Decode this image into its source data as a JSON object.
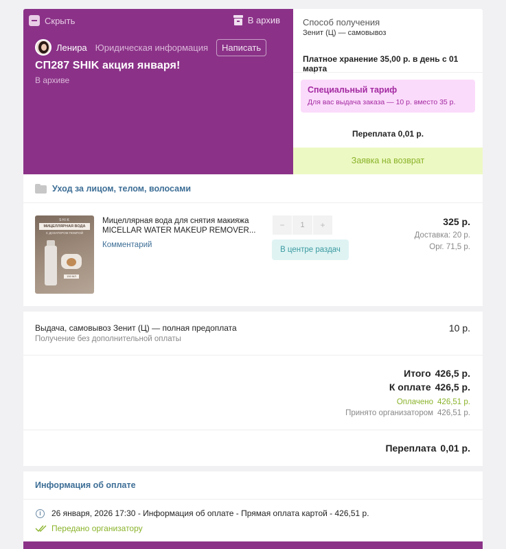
{
  "header": {
    "hide_label": "Скрыть",
    "archive_label": "В архив",
    "user_name": "Ленира",
    "legal_info": "Юридическая информация",
    "write_label": "Написать",
    "title": "СП287 SHIK акция января!",
    "status": "В архиве",
    "colors": {
      "accent": "#8b3288"
    }
  },
  "delivery_panel": {
    "method_label": "Способ получения",
    "method_value": "Зенит (Ц) — самовывоз",
    "storage_text": "Платное хранение 35,00 р. в день с 01 марта",
    "tariff_title": "Специальный тариф",
    "tariff_text": "Для вас выдача заказа — 10 р. вместо 35 р.",
    "overpay_text": "Переплата  0,01 р.",
    "refund_label": "Заявка на возврат"
  },
  "category": {
    "icon": "folder-icon",
    "label": "Уход за лицом, телом, волосами"
  },
  "product": {
    "image_brand": "SHIK",
    "image_banner": "МИЦЕЛЛЯРНАЯ ВОДА",
    "image_sub": "С ДОЗАТОРОМ ПОМПОЙ",
    "image_volume": "150 МЛ",
    "name": "Мицеллярная вода для снятия макияжа MICELLAR WATER MAKEUP REMOVER...",
    "comment_label": "Комментарий",
    "qty_minus": "−",
    "quantity": "1",
    "qty_plus": "+",
    "pickup_status": "В центре раздач",
    "price": "325 р.",
    "delivery": "Доставка: 20 р.",
    "org_fee": "Орг. 71,5 р."
  },
  "shipping": {
    "title": "Выдача, самовывоз Зенит (Ц) — полная предоплата",
    "subtitle": "Получение без дополнительной оплаты",
    "price": "10 р."
  },
  "totals": {
    "total_label": "Итого",
    "total_value": "426,5 р.",
    "to_pay_label": "К оплате",
    "to_pay_value": "426,5 р.",
    "paid_label": "Оплачено",
    "paid_value": "426,51 р.",
    "accepted_label": "Принято организатором",
    "accepted_value": "426,51 р.",
    "overpay_label": "Переплата",
    "overpay_value": "0,01 р."
  },
  "payment_info": {
    "heading": "Информация об оплате",
    "entry_text": "26 января, 2026 17:30 - Информация об оплате - Прямая оплата картой - 426,51 р.",
    "status": "Передано организатору"
  }
}
